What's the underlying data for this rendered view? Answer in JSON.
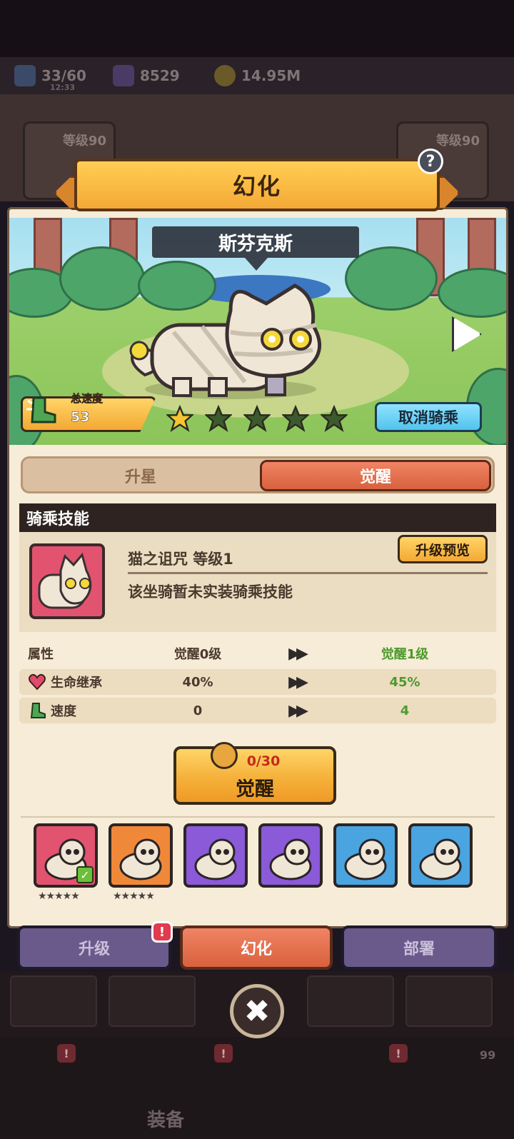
{
  "resources": {
    "energy": "33/60",
    "energy_timer": "12:33",
    "gems": "8529",
    "coins": "14.95M"
  },
  "background": {
    "card_left_level": "等级90",
    "card_right_level": "等级90",
    "nav_label": "装备",
    "nav_count": "99"
  },
  "modal": {
    "title": "幻化",
    "help": "?",
    "mount_name": "斯芬克斯",
    "speed_label": "总速度",
    "speed_value": "53",
    "stars_filled": 1,
    "stars_total": 5,
    "cancel_ride": "取消骑乘"
  },
  "tabs": {
    "star_up": "升星",
    "awaken": "觉醒",
    "active": "awaken"
  },
  "skill": {
    "header": "骑乘技能",
    "name": "猫之诅咒 等级1",
    "description": "该坐骑暂未实装骑乘技能",
    "preview_button": "升级预览"
  },
  "attributes": {
    "header": {
      "name": "属性",
      "current": "觉醒0级",
      "arrow": "▶▶",
      "next": "觉醒1级"
    },
    "rows": [
      {
        "name": "生命继承",
        "current": "40%",
        "arrow": "▶▶",
        "next": "45%",
        "icon": "heart-icon"
      },
      {
        "name": "速度",
        "current": "0",
        "arrow": "▶▶",
        "next": "4",
        "icon": "boot-icon"
      }
    ]
  },
  "awaken_button": {
    "count": "0/30",
    "label": "觉醒"
  },
  "mounts": [
    {
      "name": "mummy-cat",
      "color": "#e25370",
      "selected": true,
      "stars": "★★★★★"
    },
    {
      "name": "zebra",
      "color": "#f0883a",
      "selected": false,
      "stars": "★★★★★"
    },
    {
      "name": "pelican",
      "color": "#8a5ad8",
      "selected": false
    },
    {
      "name": "seal",
      "color": "#8a5ad8",
      "selected": false
    },
    {
      "name": "pink-axolotl",
      "color": "#4aa4e0",
      "selected": false
    },
    {
      "name": "turtle",
      "color": "#4aa4e0",
      "selected": false
    }
  ],
  "bottom_tabs": {
    "upgrade": "升级",
    "transform": "幻化",
    "deploy": "部署",
    "badge": "!"
  },
  "close": "✖"
}
